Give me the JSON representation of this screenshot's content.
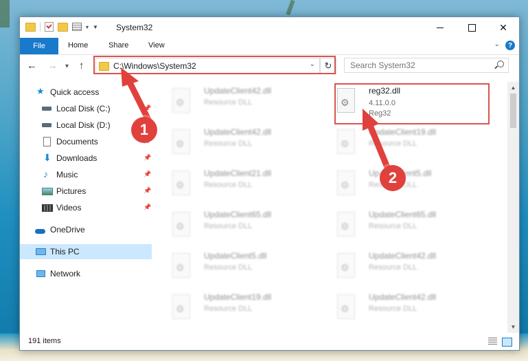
{
  "window": {
    "title": "System32"
  },
  "ribbon": {
    "tabs": [
      "File",
      "Home",
      "Share",
      "View"
    ],
    "help": "?"
  },
  "nav": {
    "address": "C:\\Windows\\System32",
    "search_placeholder": "Search System32"
  },
  "sidebar": {
    "items": [
      {
        "label": "Quick access",
        "icon": "star-icon",
        "pinned": false
      },
      {
        "label": "Local Disk (C:)",
        "icon": "drive-icon",
        "pinned": true
      },
      {
        "label": "Local Disk (D:)",
        "icon": "drive-icon",
        "pinned": false
      },
      {
        "label": "Documents",
        "icon": "documents-icon",
        "pinned": true
      },
      {
        "label": "Downloads",
        "icon": "downloads-icon",
        "pinned": true
      },
      {
        "label": "Music",
        "icon": "music-icon",
        "pinned": true
      },
      {
        "label": "Pictures",
        "icon": "pictures-icon",
        "pinned": true
      },
      {
        "label": "Videos",
        "icon": "videos-icon",
        "pinned": true
      },
      {
        "label": "OneDrive",
        "icon": "onedrive-icon",
        "pinned": false
      },
      {
        "label": "This PC",
        "icon": "this-pc-icon",
        "pinned": false
      },
      {
        "label": "Network",
        "icon": "network-icon",
        "pinned": false
      }
    ]
  },
  "files": {
    "highlighted": {
      "name": "reg32.dll",
      "version": "4.11.0.0",
      "description": "Reg32"
    },
    "left_column": [
      {
        "name": "UpdateClient42.dll",
        "type": "Resource DLL"
      },
      {
        "name": "UpdateClient42.dll",
        "type": "Resource DLL"
      },
      {
        "name": "UpdateClient21.dll",
        "type": "Resource DLL"
      },
      {
        "name": "UpdateClient65.dll",
        "type": "Resource DLL"
      },
      {
        "name": "UpdateClient5.dll",
        "type": "Resource DLL"
      },
      {
        "name": "UpdateClient19.dll",
        "type": "Resource DLL"
      }
    ],
    "right_column": [
      {
        "name": "UpdateClient19.dll",
        "type": "Resource DLL"
      },
      {
        "name": "UpdateClient5.dll",
        "type": "Resource DLL"
      },
      {
        "name": "UpdateClient65.dll",
        "type": "Resource DLL"
      },
      {
        "name": "UpdateClient42.dll",
        "type": "Resource DLL"
      },
      {
        "name": "UpdateClient42.dll",
        "type": "Resource DLL"
      }
    ]
  },
  "status": {
    "count": "191 items"
  },
  "annotations": {
    "marker1": "1",
    "marker2": "2",
    "color": "#e0413d"
  }
}
